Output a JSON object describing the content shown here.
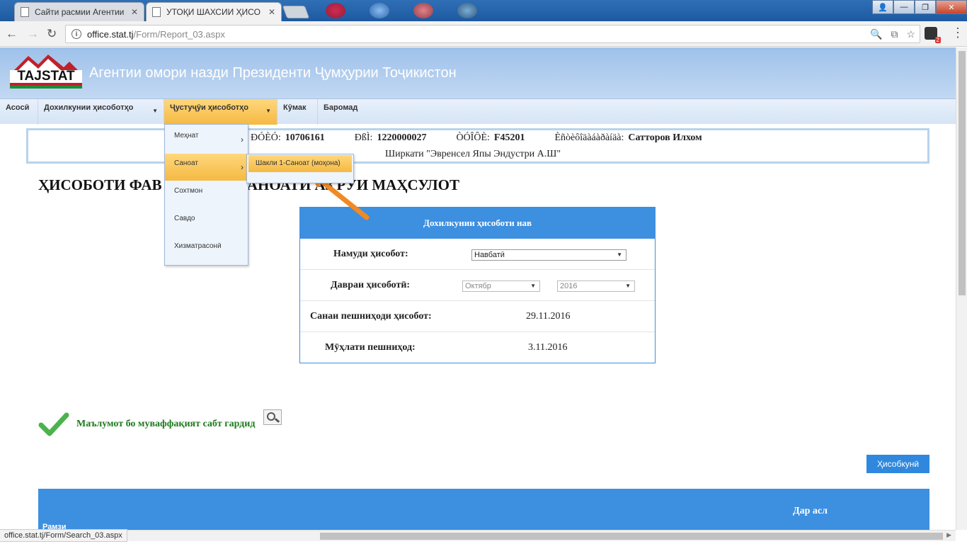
{
  "browser": {
    "tabs": [
      {
        "title": "Сайти расмии Агентии",
        "active": false
      },
      {
        "title": "УТОҚИ ШАХСИИ ҲИСО",
        "active": true
      }
    ],
    "url_host": "office.stat.tj",
    "url_path": "/Form/Report_03.aspx",
    "extension_badge": "2",
    "status_url": "office.stat.tj/Form/Search_03.aspx"
  },
  "header": {
    "logo_text": "TAJSTAT",
    "title": "Агентии омори назди Президенти Ҷумҳурии Тоҷикистон"
  },
  "nav": {
    "items": [
      {
        "label": "Асосӣ"
      },
      {
        "label": "Дохилкунии ҳисоботҳо"
      },
      {
        "label": "Ҷустуҷӯи ҳисоботҳо"
      },
      {
        "label": "Кӯмак"
      },
      {
        "label": "Баромад"
      }
    ]
  },
  "dropdown": {
    "items": [
      {
        "label": "Меҳнат"
      },
      {
        "label": "Саноат"
      },
      {
        "label": "Сохтмон"
      },
      {
        "label": "Савдо"
      },
      {
        "label": "Хизматрасонӣ"
      }
    ],
    "submenu_item": "Шакли 1-Саноат (моҳона)"
  },
  "info": {
    "k1": "ÐÓÈÓ:",
    "v1": "10706161",
    "k2": "ÐßÌ:",
    "v2": "1220000027",
    "k3": "ÒÓÎÔÈ:",
    "v3": "F45201",
    "k4": "Èñòèôîäàáàðàíäà:",
    "v4": "Сатторов Илхом",
    "company": "Ширкати \"Эвренсел Япы Эндустри А.Ш\""
  },
  "page_title": "ҲИСОБОТИ ФАВ                  ОНАҲОИ САНОАТӢ АЗ РӮИ МАҲСУЛОТ",
  "form": {
    "header": "Дохилкунии ҳисоботи нав",
    "report_type_label": "Намуди ҳисобот:",
    "report_type_value": "Навбатӣ",
    "period_label": "Давраи ҳисоботӣ:",
    "period_month": "Октябр",
    "period_year": "2016",
    "submit_date_label": "Санаи пешниҳоди ҳисобот:",
    "submit_date_value": "29.11.2016",
    "deadline_label": "Мӯҳлати пешниҳод:",
    "deadline_value": "3.11.2016"
  },
  "success_message": "Маълумот бо муваффақият сабт гардид",
  "calc_button": "Ҳисобкунӣ",
  "table": {
    "header_right": "Дар асл",
    "header_left": "Рамзи"
  },
  "colors": {
    "accent_blue": "#3d8fe0",
    "menu_highlight": "#f5b942",
    "success_green": "#1f7a1f"
  }
}
